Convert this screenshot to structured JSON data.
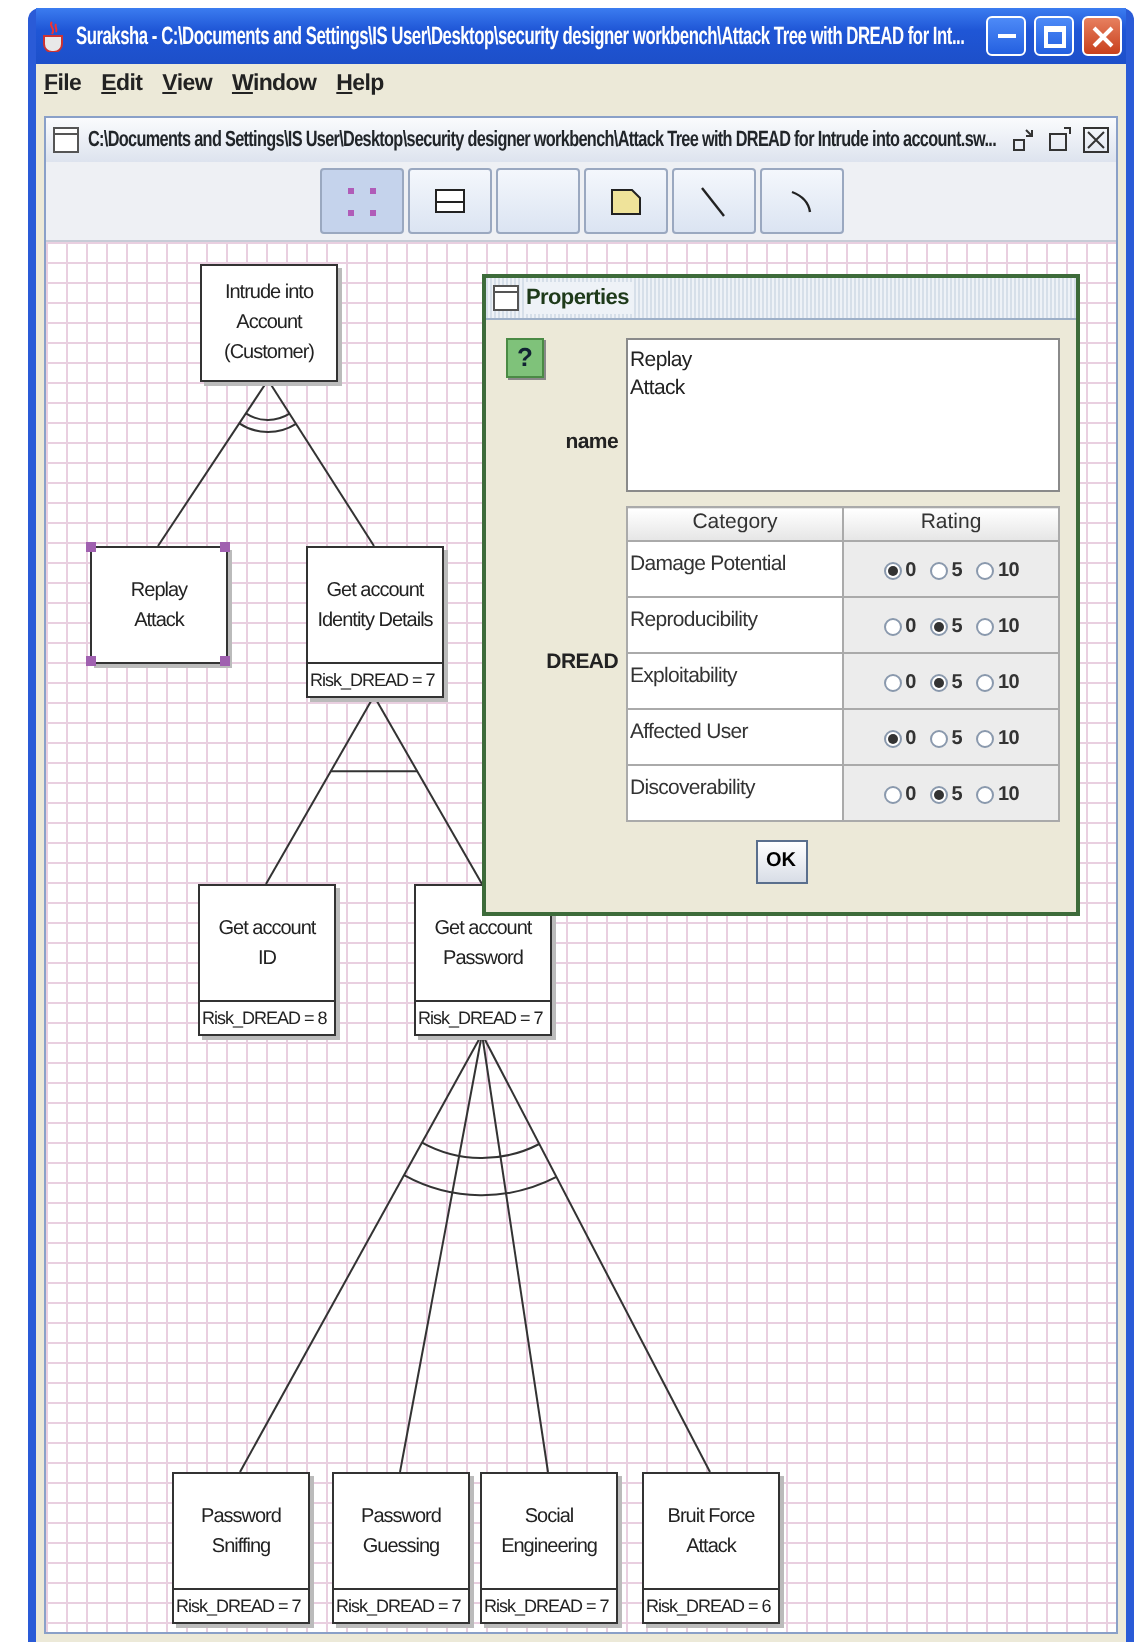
{
  "window": {
    "title": "Suraksha - C:\\Documents and Settings\\IS User\\Desktop\\security designer workbench\\Attack Tree with DREAD for Int..."
  },
  "menu": [
    {
      "label": "File"
    },
    {
      "label": "Edit"
    },
    {
      "label": "View"
    },
    {
      "label": "Window"
    },
    {
      "label": "Help"
    }
  ],
  "document": {
    "title": "C:\\Documents and Settings\\IS User\\Desktop\\security designer workbench\\Attack Tree with DREAD for Intrude into account.sw..."
  },
  "toolbar": [
    {
      "kind": "select",
      "selected": true
    },
    {
      "kind": "node",
      "selected": false
    },
    {
      "kind": "blank",
      "selected": false
    },
    {
      "kind": "note",
      "selected": false
    },
    {
      "kind": "line",
      "selected": false
    },
    {
      "kind": "arc",
      "selected": false
    }
  ],
  "tree": {
    "lines": [
      "Intrude into",
      "Account",
      "(Customer)"
    ],
    "selected": false,
    "gate": {
      "kind": "or"
    },
    "children": [
      {
        "lines": [
          "Replay",
          "Attack"
        ],
        "selected": true
      },
      {
        "lines": [
          "Get account",
          "Identity Details"
        ],
        "risk": "Risk_DREAD = 7",
        "selected": false,
        "gate": {
          "kind": "and"
        },
        "children": [
          {
            "lines": [
              "Get account",
              "ID"
            ],
            "risk": "Risk_DREAD = 8",
            "selected": false
          },
          {
            "lines": [
              "Get account",
              "Password"
            ],
            "risk": "Risk_DREAD = 7",
            "selected": false,
            "gate": {
              "kind": "or"
            },
            "children": [
              {
                "lines": [
                  "Password",
                  "Sniffing"
                ],
                "risk": "Risk_DREAD = 7",
                "selected": false
              },
              {
                "lines": [
                  "Password",
                  "Guessing"
                ],
                "risk": "Risk_DREAD = 7",
                "selected": false
              },
              {
                "lines": [
                  "Social",
                  "Engineering"
                ],
                "risk": "Risk_DREAD = 7",
                "selected": false
              },
              {
                "lines": [
                  "Bruit Force",
                  "Attack"
                ],
                "risk": "Risk_DREAD = 6",
                "selected": false
              }
            ]
          }
        ]
      }
    ]
  },
  "properties": {
    "title": "Properties",
    "help": "?",
    "name_label": "name",
    "name_value": "Replay\nAttack",
    "dread_label": "DREAD",
    "columns": [
      "Category",
      "Rating"
    ],
    "rows": [
      {
        "category": "Damage Potential",
        "options": [
          {
            "label": "0",
            "selected": true
          },
          {
            "label": "5",
            "selected": false
          },
          {
            "label": "10",
            "selected": false
          }
        ]
      },
      {
        "category": "Reproducibility",
        "options": [
          {
            "label": "0",
            "selected": false
          },
          {
            "label": "5",
            "selected": true
          },
          {
            "label": "10",
            "selected": false
          }
        ]
      },
      {
        "category": "Exploitability",
        "options": [
          {
            "label": "0",
            "selected": false
          },
          {
            "label": "5",
            "selected": true
          },
          {
            "label": "10",
            "selected": false
          }
        ]
      },
      {
        "category": "Affected User",
        "options": [
          {
            "label": "0",
            "selected": true
          },
          {
            "label": "5",
            "selected": false
          },
          {
            "label": "10",
            "selected": false
          }
        ]
      },
      {
        "category": "Discoverability",
        "options": [
          {
            "label": "0",
            "selected": false
          },
          {
            "label": "5",
            "selected": true
          },
          {
            "label": "10",
            "selected": false
          }
        ]
      }
    ],
    "ok": "OK"
  }
}
